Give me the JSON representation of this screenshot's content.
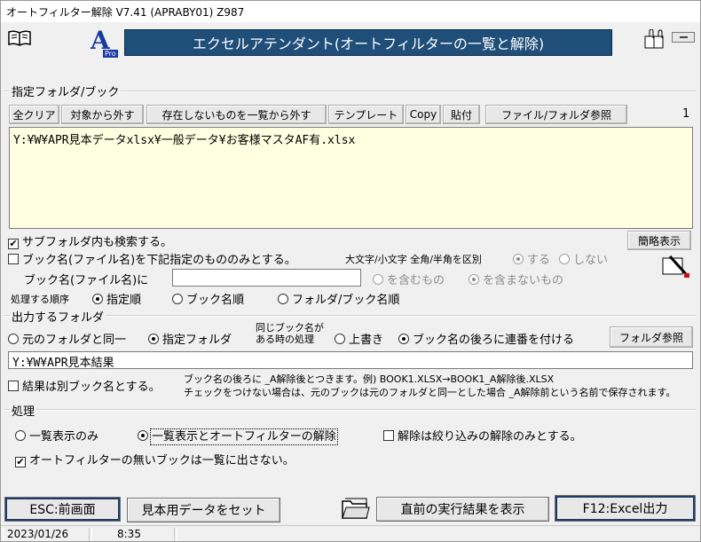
{
  "window": {
    "title": "オートフィルター解除 V7.41 (APRABY01)  Z987"
  },
  "banner": {
    "title": "エクセルアテンダント(オートフィルターの一覧と解除)"
  },
  "logo": {
    "letter": "A",
    "sub": "Pro"
  },
  "folder_group": {
    "label": "指定フォルダ/ブック",
    "buttons": [
      "全クリア",
      "対象から外す",
      "存在しないものを一覧から外す",
      "テンプレート",
      "Copy",
      "貼付",
      "ファイル/フォルダ参照"
    ],
    "count": "1",
    "path_list": "Y:¥W¥APR見本データxlsx¥一般データ¥お客様マスタAF有.xlsx",
    "subfolder_label": "サブフォルダ内も検索する。",
    "simple_view_button": "簡略表示",
    "bookname_only_label": "ブック名(ファイル名)を下記指定のもののみとする。",
    "case_label": "大文字/小文字 全角/半角を区別",
    "case_yes": "する",
    "case_no": "しない",
    "bookname_label": "ブック名(ファイル名)に",
    "bookname_value": "",
    "contains": "を含むもの",
    "not_contains": "を含まないもの",
    "order_label": "処理する順序",
    "order_options": [
      "指定順",
      "ブック名順",
      "フォルダ/ブック名順"
    ]
  },
  "output_group": {
    "label": "出力するフォルダ",
    "same_folder": "元のフォルダと同一",
    "specified_folder": "指定フォルダ",
    "same_name_label": "同じブック名が\nある時の処理",
    "overwrite": "上書き",
    "append_serial": "ブック名の後ろに連番を付ける",
    "folder_ref_button": "フォルダ参照",
    "output_path": "Y:¥W¥APR見本結果",
    "separate_name_label": "結果は別ブック名とする。",
    "note_line1": "ブック名の後ろに _A解除後とつきます。例) BOOK1.XLSX→BOOK1_A解除後.XLSX",
    "note_line2": "チェックをつけない場合は、元のブックは元のフォルダと同一とした場合 _A解除前という名前で保存されます。"
  },
  "process_group": {
    "label": "処理",
    "list_only": "一覧表示のみ",
    "list_and_clear": "一覧表示とオートフィルターの解除",
    "clear_filter_only": "解除は絞り込みの解除のみとする。",
    "hide_no_filter": "オートフィルターの無いブックは一覧に出さない。"
  },
  "bottom_buttons": {
    "esc": "ESC:前画面",
    "sample": "見本用データをセット",
    "last_result": "直前の実行結果を表示",
    "f12": "F12:Excel出力"
  },
  "status": {
    "date": "2023/01/26",
    "time": "8:35"
  },
  "colors": {
    "banner_bg": "#1f4e79",
    "textarea_bg": "#ffffe1"
  }
}
